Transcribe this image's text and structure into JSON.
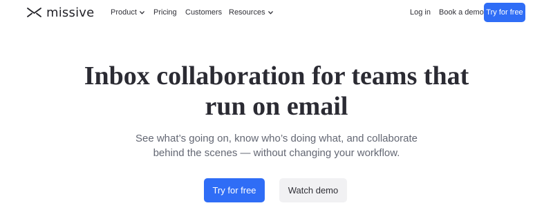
{
  "brand": {
    "name": "missive",
    "logo_icon": "missive-logo-icon"
  },
  "nav": {
    "product": "Product",
    "pricing": "Pricing",
    "customers": "Customers",
    "resources": "Resources",
    "login": "Log in",
    "book_demo": "Book a demo",
    "try_free": "Try for free"
  },
  "hero": {
    "title_line1": "Inbox collaboration for teams that",
    "title_line2": "run on email",
    "subtitle_line1": "See what’s going on, know who’s doing what, and collaborate",
    "subtitle_line2": "behind the scenes — without changing your workflow.",
    "primary_cta": "Try for free",
    "secondary_cta": "Watch demo"
  },
  "colors": {
    "accent": "#2f6df6",
    "text": "#2b2b33",
    "muted": "#636773",
    "secondary_bg": "#f1f1f3"
  }
}
